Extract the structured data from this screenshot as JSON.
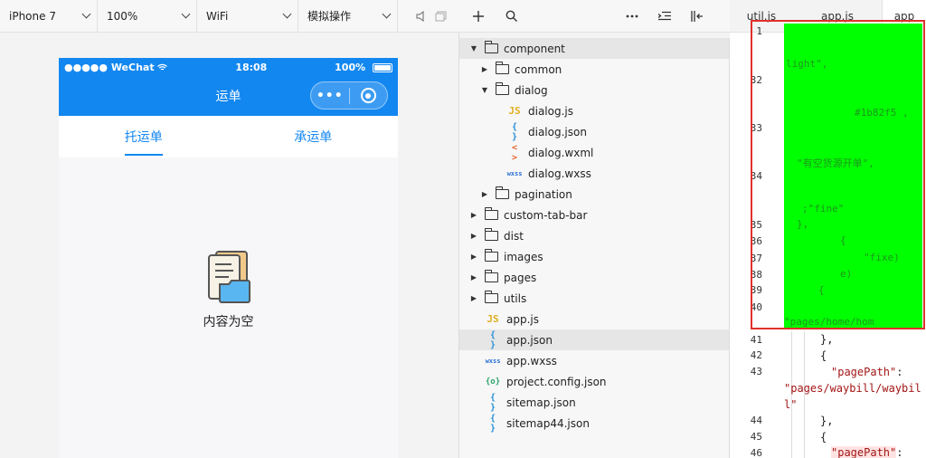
{
  "toolbar": {
    "device": "iPhone 7",
    "zoom": "100%",
    "network": "WiFi",
    "mode": "模拟操作"
  },
  "phone": {
    "carrier": "●●●●● WeChat",
    "time": "18:08",
    "battery": "100%",
    "title": "运单",
    "more": "•••",
    "tabs": [
      "托运单",
      "承运单"
    ],
    "active_tab": 0,
    "empty_text": "内容为空"
  },
  "tree": {
    "items": [
      {
        "name": "component",
        "kind": "folder",
        "depth": 0,
        "arrow": "down",
        "selected": true
      },
      {
        "name": "common",
        "kind": "folder",
        "depth": 1,
        "arrow": "right"
      },
      {
        "name": "dialog",
        "kind": "folder",
        "depth": 1,
        "arrow": "down"
      },
      {
        "name": "dialog.js",
        "kind": "js",
        "depth": 2
      },
      {
        "name": "dialog.json",
        "kind": "json",
        "depth": 2
      },
      {
        "name": "dialog.wxml",
        "kind": "wxml",
        "depth": 2
      },
      {
        "name": "dialog.wxss",
        "kind": "wxss",
        "depth": 2
      },
      {
        "name": "pagination",
        "kind": "folder",
        "depth": 1,
        "arrow": "right"
      },
      {
        "name": "custom-tab-bar",
        "kind": "folder",
        "depth": 0,
        "arrow": "right"
      },
      {
        "name": "dist",
        "kind": "folder",
        "depth": 0,
        "arrow": "right"
      },
      {
        "name": "images",
        "kind": "folder",
        "depth": 0,
        "arrow": "right"
      },
      {
        "name": "pages",
        "kind": "folder",
        "depth": 0,
        "arrow": "right"
      },
      {
        "name": "utils",
        "kind": "folder",
        "depth": 0,
        "arrow": "right"
      },
      {
        "name": "app.js",
        "kind": "js",
        "depth": 0
      },
      {
        "name": "app.json",
        "kind": "json",
        "depth": 0,
        "selected": true
      },
      {
        "name": "app.wxss",
        "kind": "wxss",
        "depth": 0
      },
      {
        "name": "project.config.json",
        "kind": "cfg",
        "depth": 0
      },
      {
        "name": "sitemap.json",
        "kind": "json",
        "depth": 0
      },
      {
        "name": "sitemap44.json",
        "kind": "json",
        "depth": 0
      }
    ]
  },
  "editor": {
    "tabs": [
      "util.js",
      "app.js",
      "app"
    ],
    "line_numbers": [
      "1",
      "32",
      "33",
      "34",
      "35",
      "36",
      "37",
      "38",
      "39",
      "40",
      "41",
      "42",
      "43",
      "44",
      "45",
      "46"
    ],
    "code": {
      "l41": "},",
      "l42": "{",
      "l43_key": "\"pagePath\"",
      "l43_colon": ":",
      "l43_val1": "\"pages/waybill/waybil",
      "l43_val2": "l\"",
      "l44": "},",
      "l45": "{",
      "l46_key": "\"pagePath\"",
      "l46_colon": ":"
    },
    "redacted_fragments": [
      "  light\",",
      "#1b82f5 ,",
      "  \"有空货源开单\",",
      "  ;\"fine\"",
      "},",
      "  {",
      "  \"fixe)",
      "  e)",
      "{",
      "\"pages/home/hom"
    ]
  },
  "colors": {
    "brand_blue": "#1387f0",
    "highlight_green": "#00ff00",
    "annotation_red": "#e0312b"
  }
}
